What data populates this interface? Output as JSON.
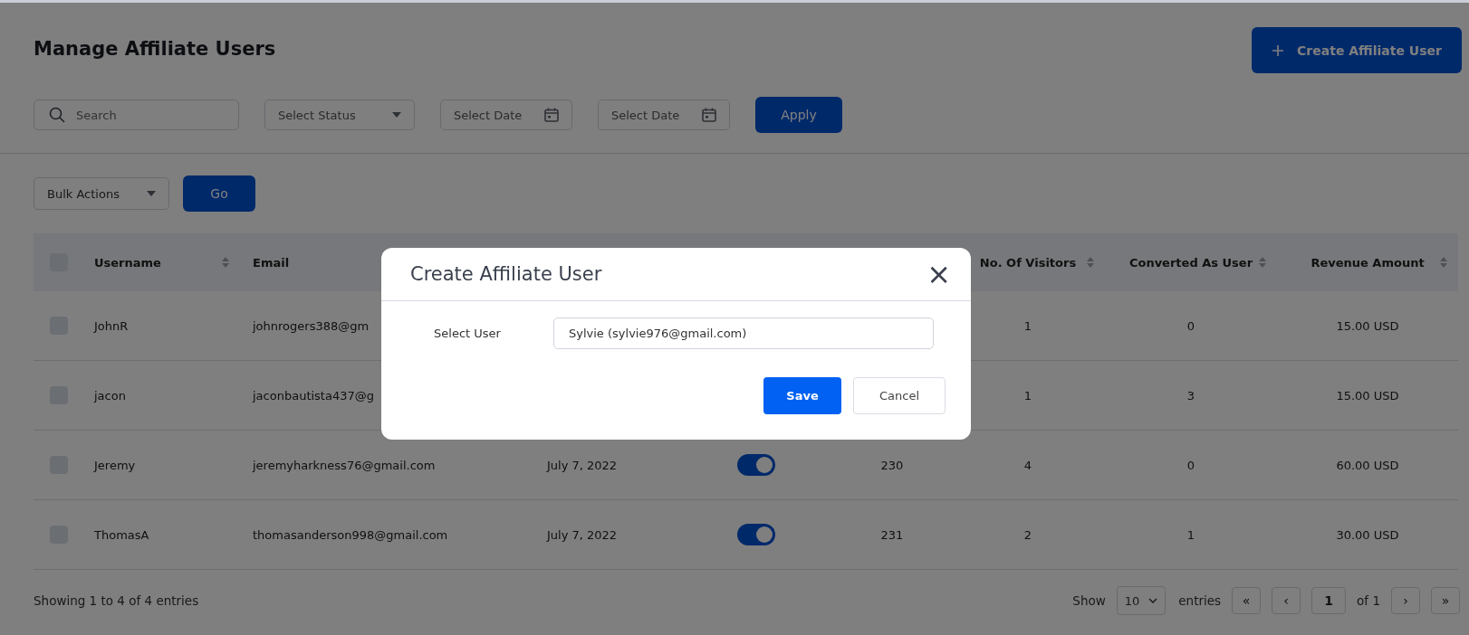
{
  "page": {
    "title": "Manage Affiliate Users",
    "create_button": "Create Affiliate User"
  },
  "filters": {
    "search": {
      "placeholder": "Search"
    },
    "status": {
      "placeholder": "Select Status"
    },
    "date_from": {
      "placeholder": "Select Date"
    },
    "date_to": {
      "placeholder": "Select Date"
    },
    "apply": "Apply"
  },
  "bulk": {
    "placeholder": "Bulk Actions",
    "go": "Go"
  },
  "table": {
    "select_all": {
      "checked": false
    },
    "columns": [
      {
        "label": "Username",
        "sortable": true
      },
      {
        "label": "Email"
      },
      {
        "label": "No. Of Visitors",
        "sortable": true
      },
      {
        "label": "Converted As User",
        "sortable": true
      },
      {
        "label": "Revenue Amount",
        "sortable": true
      }
    ],
    "rows": [
      {
        "checked": false,
        "username": "JohnR",
        "email": "johnrogers388@gm",
        "visitors": "1",
        "converted": "0",
        "revenue": "15.00 USD"
      },
      {
        "checked": false,
        "username": "jacon",
        "email": "jaconbautista437@g",
        "visitors": "1",
        "converted": "3",
        "revenue": "15.00 USD"
      },
      {
        "checked": false,
        "username": "Jeremy",
        "email": "jeremyharkness76@gmail.com",
        "column_3": "July 7, 2022",
        "column_4": {
          "on": true
        },
        "column_5": "230",
        "visitors": "4",
        "converted": "0",
        "revenue": "60.00 USD"
      },
      {
        "checked": false,
        "username": "ThomasA",
        "email": "thomasanderson998@gmail.com",
        "column_3": "July 7, 2022",
        "column_4": {
          "on": true
        },
        "column_5": "231",
        "visitors": "2",
        "converted": "1",
        "revenue": "30.00 USD"
      }
    ]
  },
  "footer": {
    "summary": "Showing 1 to 4 of 4 entries",
    "show": "Show",
    "page_size": "10",
    "entries": "entries",
    "first": "«",
    "prev": "‹",
    "page": "1",
    "of": "of 1",
    "next": "›",
    "last": "»"
  },
  "modal": {
    "title": "Create Affiliate User",
    "close": "×",
    "field_label": "Select User",
    "field_value": "Sylvie (sylvie976@gmail.com)",
    "save": "Save",
    "cancel": "Cancel"
  }
}
